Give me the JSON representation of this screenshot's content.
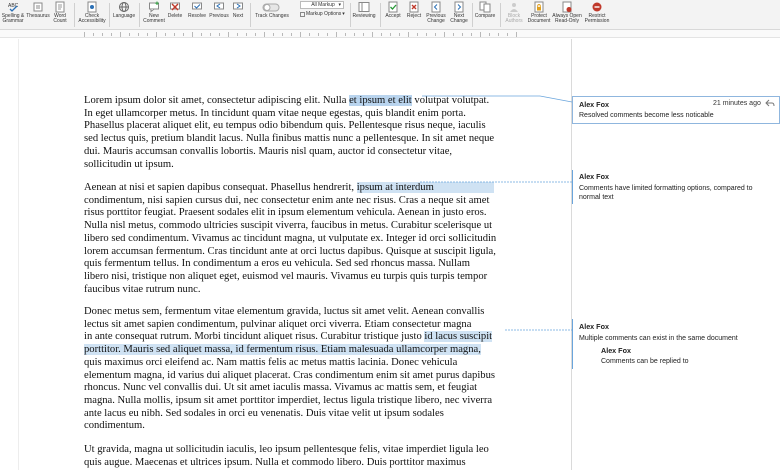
{
  "ribbon": {
    "spelling": "Spelling &\nGrammar",
    "thesaurus": "Thesaurus",
    "word_count": "Word\nCount",
    "check_accessibility": "Check\nAccessibility",
    "language": "Language",
    "new_comment": "New\nComment",
    "delete": "Delete",
    "resolve": "Resolve",
    "previous": "Previous",
    "next": "Next",
    "track_changes": "Track Changes",
    "markup_select": "All Markup",
    "markup_options": "Markup Options",
    "reviewing": "Reviewing",
    "accept": "Accept",
    "reject": "Reject",
    "previous_change": "Previous\nChange",
    "next_change": "Next\nChange",
    "compare": "Compare",
    "block_authors": "Block\nAuthors",
    "protect_document": "Protect\nDocument",
    "always_open_read_only": "Always Open\nRead-Only",
    "restrict_permission": "Restrict\nPermission"
  },
  "document": {
    "paragraphs": [
      {
        "lines": [
          [
            "Lorem ipsum dolor sit amet, consectetur adipiscing elit. Nulla ",
            "et ipsum et elit",
            " volutpat volutpat."
          ],
          [
            "In eget ullamcorper metus. In tincidunt quam vitae neque egestas, quis blandit enim porta."
          ],
          [
            "Phasellus placerat aliquet elit, eu tempus odio bibendum quis. Pellentesque risus neque, iaculis"
          ],
          [
            "sed lectus quis, pretium blandit lacus. Nulla finibus mattis nunc a pellentesque. In sit amet neque"
          ],
          [
            "dui. Mauris accumsan convallis lobortis. Mauris nisl quam, auctor id consectetur vitae,"
          ],
          [
            "sollicitudin ut ipsum."
          ]
        ]
      },
      {
        "lines": [
          [
            "Aenean at nisi et sapien dapibus consequat. Phasellus hendrerit, ",
            "ipsum at interdum",
            ""
          ],
          [
            "condimentum, nisi sapien cursus dui, nec consectetur enim ante nec risus. Cras a neque sit amet"
          ],
          [
            "risus porttitor feugiat. Praesent sodales elit in ipsum elementum vehicula. Aenean in justo eros."
          ],
          [
            "Nulla nisl metus, commodo ultricies suscipit viverra, faucibus in metus. Curabitur scelerisque ut"
          ],
          [
            "libero sed condimentum. Vivamus ac tincidunt magna, ut vulputate ex. Integer id orci sollicitudin"
          ],
          [
            "lorem accumsan fermentum. Cras tincidunt ante at orci luctus dapibus. Quisque at suscipit ligula,"
          ],
          [
            "quis fermentum tellus. In condimentum a eros eu vehicula. Sed sed rhoncus massa. Nullam"
          ],
          [
            "libero nisi, tristique non aliquet eget, euismod vel mauris. Vivamus eu turpis quis turpis tempor"
          ],
          [
            "faucibus vitae rutrum nunc."
          ]
        ]
      },
      {
        "lines": [
          [
            "Donec metus sem, fermentum vitae elementum gravida, luctus sit amet velit. Aenean convallis"
          ],
          [
            "lectus sit amet sapien condimentum, pulvinar aliquet orci viverra. Etiam consectetur         magna"
          ],
          [
            "in ante consequat rutrum. Morbi tincidunt aliquet risus. Curabitur tristique justo ",
            "id lacus suscipit",
            ""
          ],
          [
            "",
            "porttitor. Mauris sed aliquet massa, id fermentum risus. Etiam malesuada ullamcorper magna,",
            ""
          ],
          [
            "quis maximus orci eleifend ac. Nam mattis felis ac metus mattis lacinia. Donec vehicula"
          ],
          [
            "elementum magna, id varius dui aliquet placerat. Cras condimentum enim sit amet purus dapibus"
          ],
          [
            "rhoncus. Nunc vel convallis dui. Ut sit amet iaculis massa. Vivamus ac mattis sem, et feugiat"
          ],
          [
            "magna. Nulla mollis, ipsum sit amet porttitor imperdiet, lectus ligula tristique libero, nec viverra"
          ],
          [
            "ante lacus eu nibh. Sed sodales in orci eu venenatis. Duis vitae velit ut ipsum sodales"
          ],
          [
            "condimentum."
          ]
        ]
      },
      {
        "lines": [
          [
            "Ut gravida, magna ut sollicitudin iaculis, leo ipsum pellentesque felis, vitae imperdiet ligula leo"
          ],
          [
            "quis augue. Maecenas et ultrices ipsum. Nulla et commodo libero. Duis porttitor maximus"
          ]
        ]
      }
    ]
  },
  "comments": [
    {
      "author": "Alex Fox",
      "time": "21 minutes ago",
      "text": "Resolved comments become less noticable"
    },
    {
      "author": "Alex Fox",
      "text": "Comments have limited formatting options, compared to normal text"
    },
    {
      "author": "Alex Fox",
      "text": "Multiple comments can exist in the same document"
    },
    {
      "author": "Alex Fox",
      "text": "Comments can be replied to"
    }
  ],
  "colors": {
    "highlight": "#cfe2f3",
    "comment_line": "#6aa5dc",
    "ribbon_bg": "#f3f3f3"
  },
  "icons": [
    "spelling-icon",
    "thesaurus-icon",
    "word-count-icon",
    "accessibility-icon",
    "language-icon",
    "new-comment-icon",
    "delete-icon",
    "resolve-icon",
    "previous-icon",
    "next-icon",
    "toggle-icon",
    "reviewing-icon",
    "accept-icon",
    "reject-icon",
    "previous-change-icon",
    "next-change-icon",
    "compare-icon",
    "block-authors-icon",
    "protect-icon",
    "read-only-icon",
    "restrict-icon",
    "reply-icon"
  ]
}
